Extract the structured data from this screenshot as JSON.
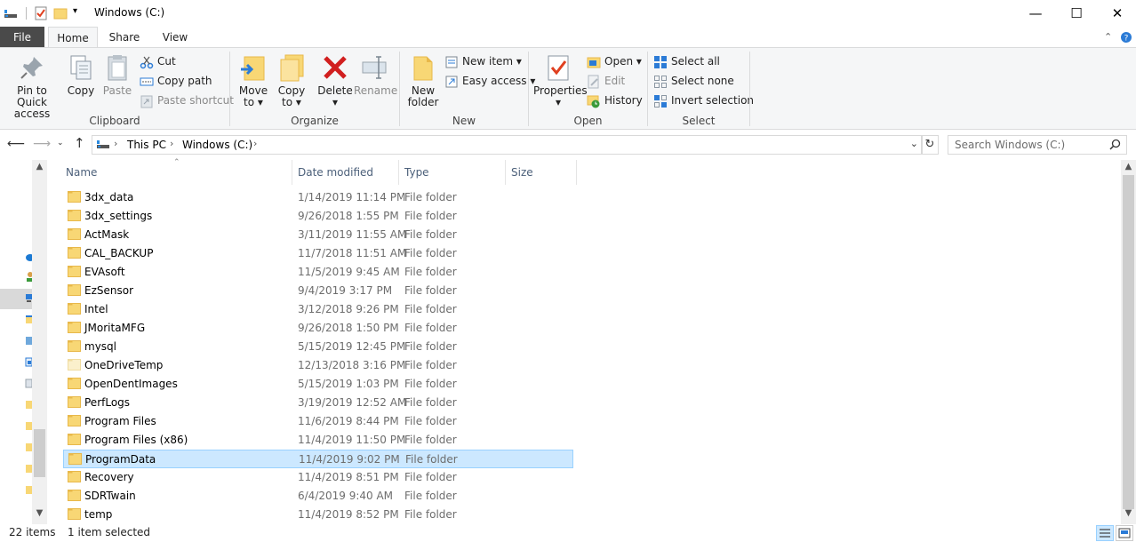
{
  "window": {
    "title": "Windows (C:)",
    "minimize_glyph": "—",
    "maximize_glyph": "☐",
    "close_glyph": "✕"
  },
  "ribbon_tabs": {
    "file": "File",
    "home": "Home",
    "share": "Share",
    "view": "View"
  },
  "ribbon": {
    "clipboard": {
      "label": "Clipboard",
      "pin_line1": "Pin to Quick",
      "pin_line2": "access",
      "copy": "Copy",
      "paste": "Paste",
      "cut": "Cut",
      "copy_path": "Copy path",
      "paste_shortcut": "Paste shortcut"
    },
    "organize": {
      "label": "Organize",
      "move_line1": "Move",
      "move_line2": "to ▾",
      "copy_line1": "Copy",
      "copy_line2": "to ▾",
      "delete_line1": "Delete",
      "delete_line2": "▾",
      "rename": "Rename"
    },
    "new": {
      "label": "New",
      "new_folder_line1": "New",
      "new_folder_line2": "folder",
      "new_item": "New item ▾",
      "easy_access": "Easy access ▾"
    },
    "open": {
      "label": "Open",
      "properties_line1": "Properties",
      "properties_line2": "▾",
      "open": "Open ▾",
      "edit": "Edit",
      "history": "History"
    },
    "select": {
      "label": "Select",
      "select_all": "Select all",
      "select_none": "Select none",
      "invert_selection": "Invert selection"
    }
  },
  "address_bar": {
    "crumb_this_pc": "This PC",
    "crumb_drive": "Windows (C:)",
    "separator": "›"
  },
  "search": {
    "placeholder": "Search Windows (C:)"
  },
  "columns": {
    "name": "Name",
    "date_modified": "Date modified",
    "type": "Type",
    "size": "Size"
  },
  "files": [
    {
      "name": "3dx_data",
      "date": "1/14/2019 11:14 PM",
      "type": "File folder"
    },
    {
      "name": "3dx_settings",
      "date": "9/26/2018 1:55 PM",
      "type": "File folder"
    },
    {
      "name": "ActMask",
      "date": "3/11/2019 11:55 AM",
      "type": "File folder"
    },
    {
      "name": "CAL_BACKUP",
      "date": "11/7/2018 11:51 AM",
      "type": "File folder"
    },
    {
      "name": "EVAsoft",
      "date": "11/5/2019 9:45 AM",
      "type": "File folder"
    },
    {
      "name": "EzSensor",
      "date": "9/4/2019 3:17 PM",
      "type": "File folder"
    },
    {
      "name": "Intel",
      "date": "3/12/2018 9:26 PM",
      "type": "File folder"
    },
    {
      "name": "JMoritaMFG",
      "date": "9/26/2018 1:50 PM",
      "type": "File folder"
    },
    {
      "name": "mysql",
      "date": "5/15/2019 12:45 PM",
      "type": "File folder"
    },
    {
      "name": "OneDriveTemp",
      "date": "12/13/2018 3:16 PM",
      "type": "File folder"
    },
    {
      "name": "OpenDentImages",
      "date": "5/15/2019 1:03 PM",
      "type": "File folder"
    },
    {
      "name": "PerfLogs",
      "date": "3/19/2019 12:52 AM",
      "type": "File folder"
    },
    {
      "name": "Program Files",
      "date": "11/6/2019 8:44 PM",
      "type": "File folder"
    },
    {
      "name": "Program Files (x86)",
      "date": "11/4/2019 11:50 PM",
      "type": "File folder"
    },
    {
      "name": "ProgramData",
      "date": "11/4/2019 9:02 PM",
      "type": "File folder"
    },
    {
      "name": "Recovery",
      "date": "11/4/2019 8:51 PM",
      "type": "File folder"
    },
    {
      "name": "SDRTwain",
      "date": "6/4/2019 9:40 AM",
      "type": "File folder"
    },
    {
      "name": "temp",
      "date": "11/4/2019 8:52 PM",
      "type": "File folder"
    }
  ],
  "selected_file": "ProgramData",
  "status": {
    "item_count": "22 items",
    "selection": "1 item selected"
  },
  "colors": {
    "folder": "#f8d775",
    "folder_dark": "#e8b84a",
    "selection_bg": "#cce8ff",
    "selection_border": "#99d1ff",
    "file_tab": "#4a4a4a",
    "header_text": "#4c607a"
  }
}
